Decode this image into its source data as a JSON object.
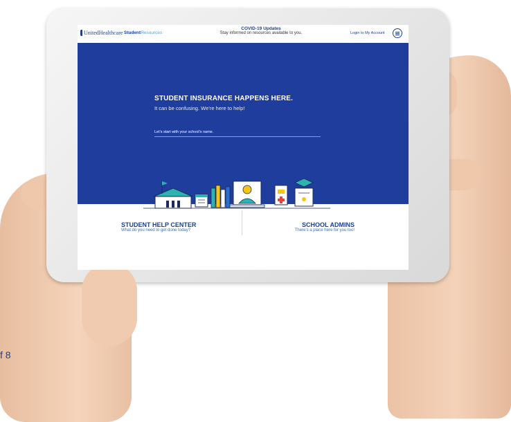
{
  "page_counter": "f 8",
  "header": {
    "logo_text": "UnitedHealthcare",
    "sub_brand_bold": "Student",
    "sub_brand_light": "Resources",
    "covid_title": "COVID-19 Updates",
    "covid_subtitle": "Stay informed on resources available to you.",
    "login_label": "Login to My Account",
    "menu_icon": "hamburger-menu-icon"
  },
  "hero": {
    "title": "STUDENT INSURANCE HAPPENS HERE.",
    "subtitle": "It can be confusing. We’re here to help!",
    "search_placeholder": "Let's start with your school's name."
  },
  "sections": [
    {
      "title": "STUDENT HELP CENTER",
      "subtitle": "What do you need to get done today?"
    },
    {
      "title": "SCHOOL ADMINS",
      "subtitle": "There’s a place here for you too!"
    }
  ],
  "colors": {
    "brand_blue": "#1f3d9c",
    "accent_blue": "#2f6fc0",
    "illustration_teal": "#2bb3b1",
    "illustration_yellow": "#f5c518"
  }
}
